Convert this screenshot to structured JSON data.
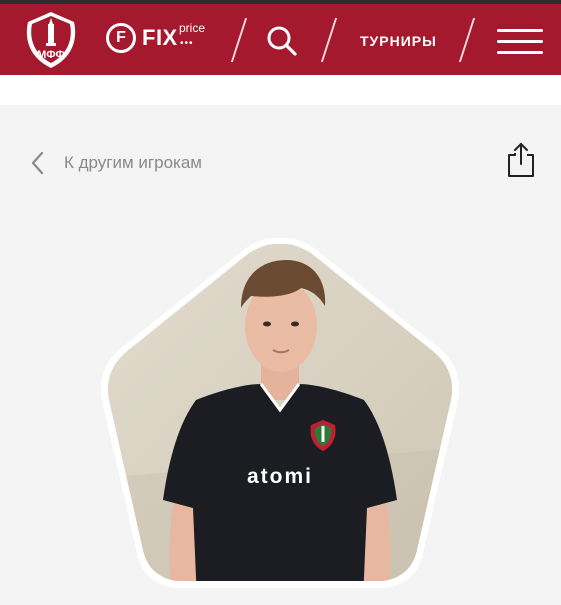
{
  "header": {
    "logo_icon": "club-crest-logo",
    "logo_text": "МФФ",
    "sponsor_mark": "F",
    "sponsor_name": "FIX",
    "sponsor_suffix": "price",
    "sponsor_dots": "•••",
    "search_icon": "search-icon",
    "nav_link": "ТУРНИРЫ",
    "menu_icon": "hamburger-menu-icon",
    "colors": {
      "brand": "#a5192e",
      "white": "#ffffff"
    }
  },
  "player_page": {
    "back_label": "К другим игрокам",
    "back_icon": "chevron-left-icon",
    "share_icon": "share-icon",
    "photo": {
      "shirt_brand": "atomi",
      "colors": {
        "frame": "#ffffff",
        "wall": "#dad3c4",
        "shirt": "#1b1d22"
      }
    }
  }
}
